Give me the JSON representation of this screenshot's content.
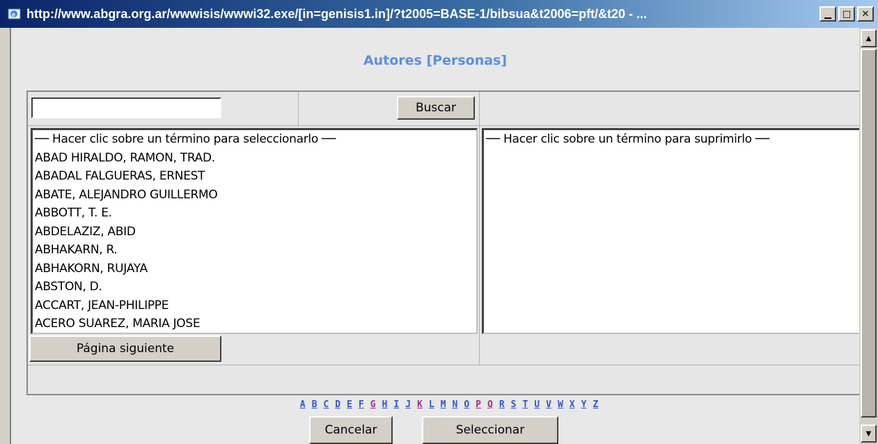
{
  "window": {
    "title": "http://www.abgra.org.ar/wwwisis/wwwi32.exe/[in=genisis1.in]/?t2005=BASE-1/bibsua&t2006=pft/&t20 - ...",
    "minimize_glyph": "▁",
    "maximize_glyph": "□",
    "close_glyph": "✕"
  },
  "heading": "Autores [Personas]",
  "search": {
    "value": "",
    "button_label": "Buscar"
  },
  "left_list": {
    "header": "── Hacer clic sobre un término para seleccionarlo ──",
    "items": [
      "ABAD HIRALDO, RAMON, TRAD.",
      "ABADAL FALGUERAS, ERNEST",
      "ABATE, ALEJANDRO GUILLERMO",
      "ABBOTT, T. E.",
      "ABDELAZIZ, ABID",
      "ABHAKARN, R.",
      "ABHAKORN, RUJAYA",
      "ABSTON, D.",
      "ACCART, JEAN-PHILIPPE",
      "ACERO SUAREZ, MARIA JOSE"
    ]
  },
  "right_list": {
    "header": "── Hacer clic sobre un término para suprimirlo ──"
  },
  "next_page_label": "Página siguiente",
  "letters": [
    "A",
    "B",
    "C",
    "D",
    "E",
    "F",
    "G",
    "H",
    "I",
    "J",
    "K",
    "L",
    "M",
    "N",
    "O",
    "P",
    "Q",
    "R",
    "S",
    "T",
    "U",
    "V",
    "W",
    "X",
    "Y",
    "Z"
  ],
  "visited_letters": [
    "G",
    "K",
    "P",
    "Q"
  ],
  "link_color": "#3355cc",
  "visited_link_color": "#a0308a",
  "heading_color": "#5b8fe0",
  "cancel_label": "Cancelar",
  "select_label": "Seleccionar"
}
